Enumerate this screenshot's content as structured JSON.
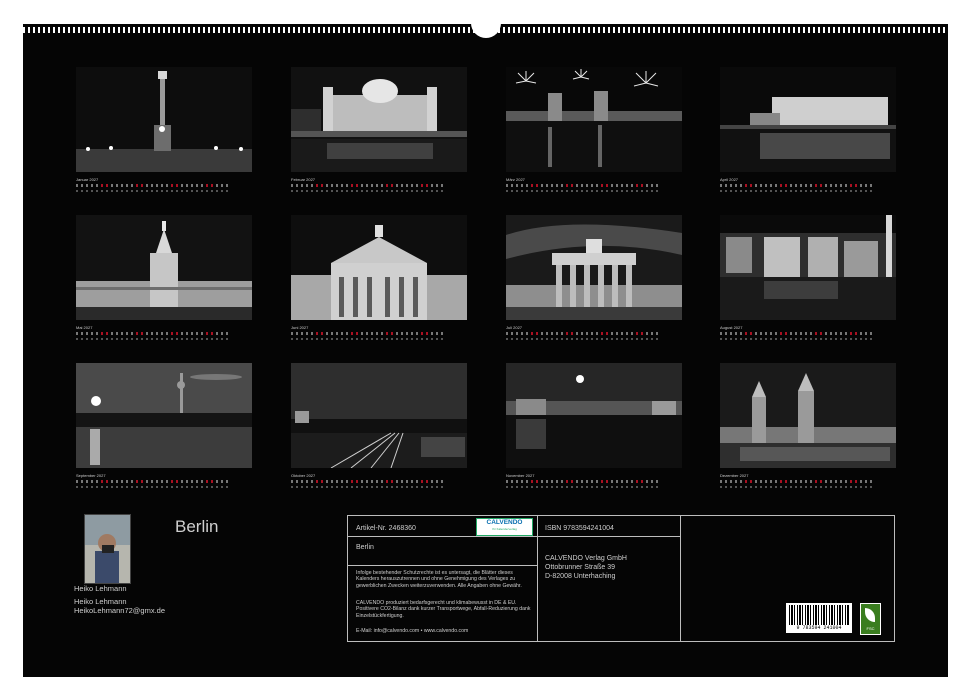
{
  "calendar": {
    "title": "Berlin",
    "months": [
      {
        "label": "Januar 2027"
      },
      {
        "label": "Februar 2027"
      },
      {
        "label": "März 2027"
      },
      {
        "label": "April 2027"
      },
      {
        "label": "Mai 2027"
      },
      {
        "label": "Juni 2027"
      },
      {
        "label": "Juli 2027"
      },
      {
        "label": "August 2027"
      },
      {
        "label": "September 2027"
      },
      {
        "label": "Oktober 2027"
      },
      {
        "label": "November 2027"
      },
      {
        "label": "Dezember 2027"
      }
    ]
  },
  "author": {
    "photo_label": "Heiko Lehmann",
    "name": "Heiko Lehmann",
    "email": "HeikoLehmann72@gmx.de"
  },
  "info": {
    "article_no": "Artikel-Nr. 2468360",
    "calendar_title": "Berlin",
    "logo_text": "CALVENDO",
    "logo_sub": "Ihr Kalenderverlag",
    "legal_notice": "Infolge bestehender Schutzrechte ist es untersagt, die Blätter dieses Kalenders herauszutrennen und ohne Genehmigung des Verlages zu gewerblichen Zwecken weiterzuverwenden. Alle Angaben ohne Gewähr.",
    "eco_notice": "CALVENDO produziert bedarfsgerecht und klimabewusst in DE & EU. Positivere CO2-Bilanz dank kurzer Transportwege, Abfall-Reduzierung dank Einzelstückfertigung.",
    "contact": "E-Mail: info@calvendo.com • www.calvendo.com",
    "isbn": "ISBN 9783594241004",
    "publisher_name": "CALVENDO Verlag GmbH",
    "publisher_street": "Ottobrunner Straße 39",
    "publisher_city": "D-82008 Unterhaching",
    "barcode_number": "9 783594 241004",
    "fsc_label": "FSC"
  }
}
